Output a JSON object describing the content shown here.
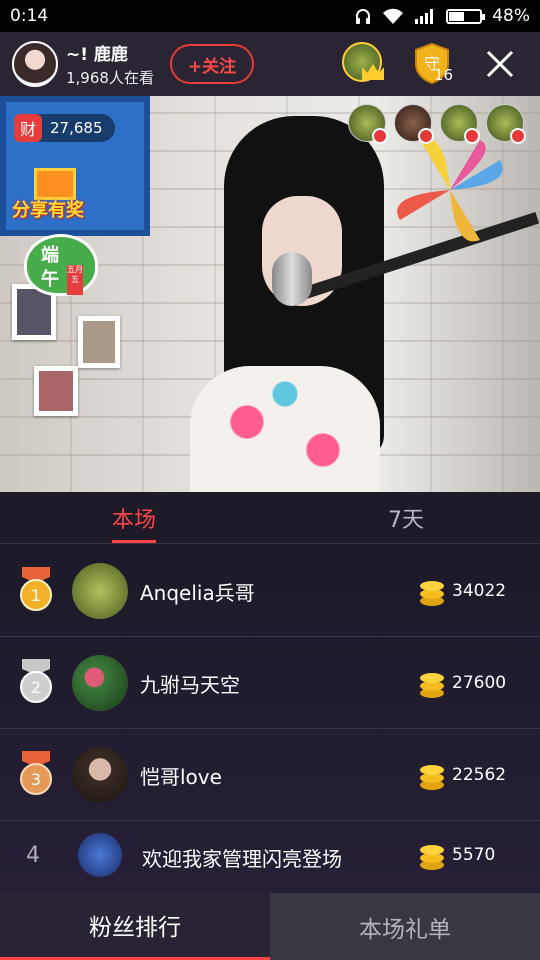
{
  "status_bar": {
    "time": "0:14",
    "battery": "48%",
    "battery_level": 0.48
  },
  "header": {
    "anchor_name": "~! 鹿鹿",
    "viewer_count": "1,968人在看",
    "follow_label": "+关注",
    "guard_count": "16"
  },
  "video": {
    "wealth_label": "财",
    "wealth_value": "27,685",
    "share_label": "分享有奖",
    "festival_chars": [
      "端",
      "午"
    ],
    "festival_tag": "五月五"
  },
  "tabs": [
    {
      "label": "本场",
      "active": true
    },
    {
      "label": "7天",
      "active": false
    }
  ],
  "ranking": [
    {
      "rank": 1,
      "name": "Anqelia兵哥",
      "amount": "34022",
      "medal": "gold"
    },
    {
      "rank": 2,
      "name": "九驸马天空",
      "amount": "27600",
      "medal": "silver"
    },
    {
      "rank": 3,
      "name": "恺哥love",
      "amount": "22562",
      "medal": "bronze"
    },
    {
      "rank": 4,
      "name": "欢迎我家管理闪亮登场",
      "amount": "5570",
      "medal": "none"
    }
  ],
  "bottom_tabs": [
    {
      "label": "粉丝排行",
      "active": true
    },
    {
      "label": "本场礼单",
      "active": false
    }
  ],
  "colors": {
    "accent": "#ff4646",
    "gold": "#ffc21a",
    "background": "#1c1a27"
  }
}
